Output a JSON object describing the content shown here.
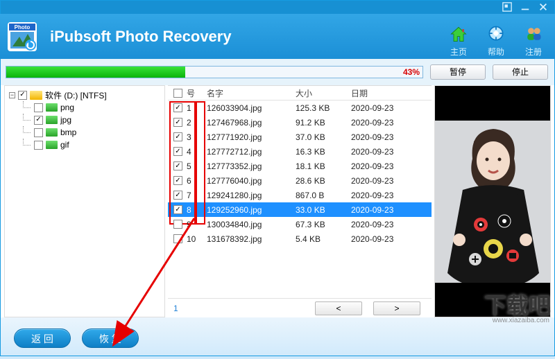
{
  "topbar": {
    "settings_icon": "settings",
    "min_icon": "minimize",
    "close_icon": "close"
  },
  "header": {
    "app_title": "iPubsoft Photo Recovery",
    "nav": [
      {
        "label": "主页",
        "icon": "home"
      },
      {
        "label": "帮助",
        "icon": "help"
      },
      {
        "label": "注册",
        "icon": "register"
      }
    ]
  },
  "progress": {
    "pct_text": "43%",
    "pct_value": 43,
    "pause_label": "暂停",
    "stop_label": "停止"
  },
  "tree": {
    "root": {
      "label": "软件 (D:) [NTFS]",
      "checked": true
    },
    "children": [
      {
        "label": "png",
        "checked": false
      },
      {
        "label": "jpg",
        "checked": true
      },
      {
        "label": "bmp",
        "checked": false
      },
      {
        "label": "gif",
        "checked": false
      }
    ]
  },
  "grid": {
    "headers": {
      "num": "号",
      "name": "名字",
      "size": "大小",
      "date": "日期"
    },
    "rows": [
      {
        "num": "1",
        "name": "126033904.jpg",
        "size": "125.3 KB",
        "date": "2020-09-23",
        "checked": true
      },
      {
        "num": "2",
        "name": "127467968.jpg",
        "size": "91.2 KB",
        "date": "2020-09-23",
        "checked": true
      },
      {
        "num": "3",
        "name": "127771920.jpg",
        "size": "37.0 KB",
        "date": "2020-09-23",
        "checked": true
      },
      {
        "num": "4",
        "name": "127772712.jpg",
        "size": "16.3 KB",
        "date": "2020-09-23",
        "checked": true
      },
      {
        "num": "5",
        "name": "127773352.jpg",
        "size": "18.1 KB",
        "date": "2020-09-23",
        "checked": true
      },
      {
        "num": "6",
        "name": "127776040.jpg",
        "size": "28.6 KB",
        "date": "2020-09-23",
        "checked": true
      },
      {
        "num": "7",
        "name": "129241280.jpg",
        "size": "867.0 B",
        "date": "2020-09-23",
        "checked": true
      },
      {
        "num": "8",
        "name": "129252960.jpg",
        "size": "33.0 KB",
        "date": "2020-09-23",
        "checked": true,
        "selected": true
      },
      {
        "num": "9",
        "name": "130034840.jpg",
        "size": "67.3 KB",
        "date": "2020-09-23",
        "checked": false
      },
      {
        "num": "10",
        "name": "131678392.jpg",
        "size": "5.4 KB",
        "date": "2020-09-23",
        "checked": false
      }
    ],
    "page": "1",
    "prev": "<",
    "next": ">"
  },
  "footer": {
    "back": "返 回",
    "recover": "恢 复"
  },
  "watermark": {
    "big": "下载吧",
    "url": "www.xiazaiba.com"
  }
}
